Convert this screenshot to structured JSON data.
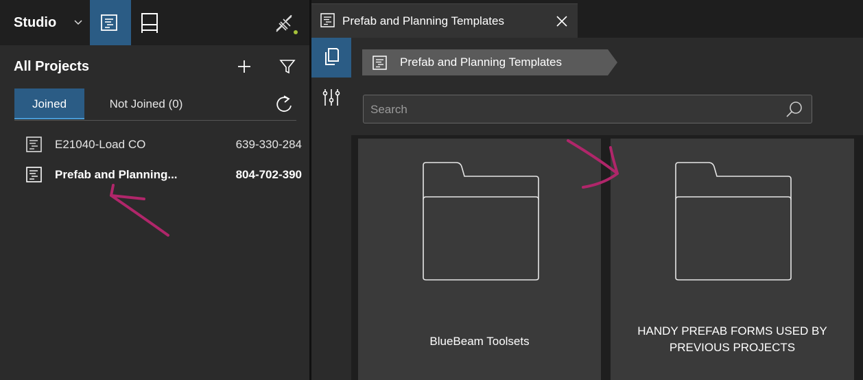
{
  "studio": {
    "title": "Studio",
    "icons": [
      "chevron-down-icon",
      "projects-icon",
      "sessions-icon",
      "disconnected-plug-icon"
    ],
    "status_color": "#a6c23a",
    "accent_color": "#2b5c85"
  },
  "projects_panel": {
    "title": "All Projects",
    "tabs": [
      {
        "label": "Joined",
        "active": true
      },
      {
        "label": "Not Joined (0)",
        "active": false
      }
    ],
    "items": [
      {
        "name": "E21040-Load CO",
        "id": "639-330-284",
        "selected": false
      },
      {
        "name": "Prefab and Planning...",
        "id": "804-702-390",
        "selected": true
      }
    ]
  },
  "document_tab": {
    "label": "Prefab and Planning Templates"
  },
  "breadcrumb": {
    "label": "Prefab and Planning Templates"
  },
  "search": {
    "placeholder": "Search"
  },
  "folders": [
    {
      "label": "BlueBeam Toolsets"
    },
    {
      "label_line1": "HANDY PREFAB FORMS USED BY",
      "label_line2": "PREVIOUS PROJECTS"
    }
  ],
  "annotation_color": "#b0266a"
}
